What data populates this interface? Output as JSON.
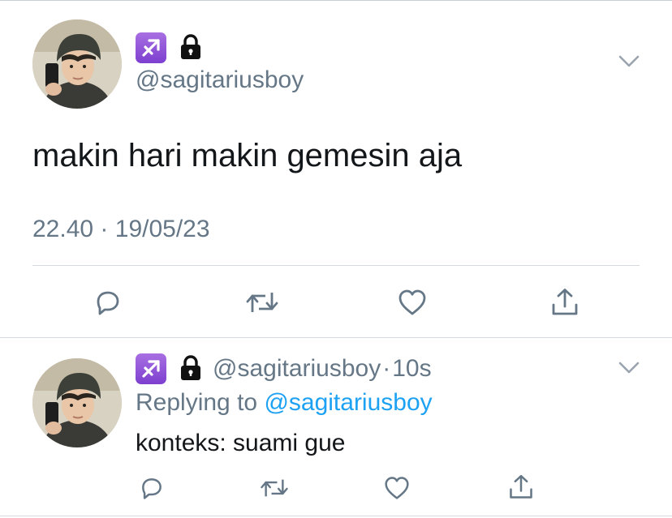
{
  "tweet": {
    "handle": "@sagitariusboy",
    "text": "makin hari makin gemesin aja",
    "time": "22.40",
    "separator": "·",
    "date": "19/05/23"
  },
  "reply": {
    "handle": "@sagitariusboy",
    "separator": "·",
    "age": "10s",
    "replying_prefix": "Replying to",
    "replying_to": "@sagitariusboy",
    "text": "konteks: suami gue"
  },
  "icons": {
    "zodiac": "sagittarius-emoji-icon",
    "lock": "lock-icon",
    "more": "chevron-down-icon",
    "reply": "reply-icon",
    "retweet": "retweet-icon",
    "like": "heart-icon",
    "share": "share-icon"
  },
  "colors": {
    "link": "#1da1f2",
    "secondary_text": "#657786",
    "primary_text": "#14171a",
    "icon": "#657786",
    "zodiac_bg": "#8c4fd8"
  }
}
